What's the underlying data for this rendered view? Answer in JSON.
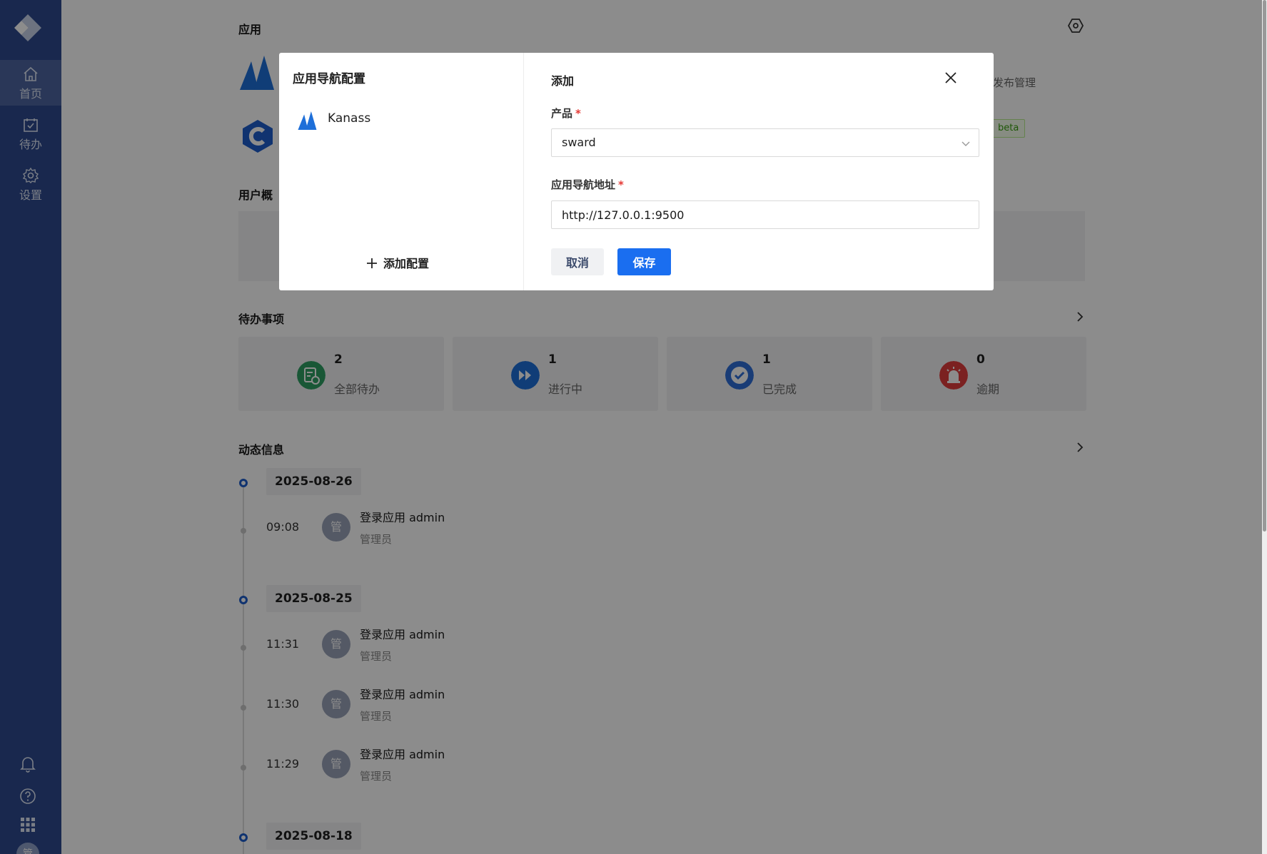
{
  "sidebar": {
    "items": [
      {
        "label": "首页",
        "icon": "home-icon"
      },
      {
        "label": "待办",
        "icon": "todo-icon"
      },
      {
        "label": "设置",
        "icon": "settings-icon"
      }
    ],
    "bottom_icons": [
      "bell-icon",
      "help-icon",
      "apps-grid-icon"
    ],
    "avatar_text": "管"
  },
  "main": {
    "apps_title": "应用",
    "apps_partial_text": "发布管理",
    "apps_badge": "beta",
    "users_title": "用户概",
    "todo_title": "待办事项",
    "todo_cards": [
      {
        "count": "2",
        "label": "全部待办",
        "color": "#2e9e63"
      },
      {
        "count": "1",
        "label": "进行中",
        "color": "#1e6fd9"
      },
      {
        "count": "1",
        "label": "已完成",
        "color": "#2f6ed8"
      },
      {
        "count": "0",
        "label": "逾期",
        "color": "#e03c3c"
      }
    ],
    "activity_title": "动态信息",
    "timeline": [
      {
        "date": "2025-08-26",
        "entries": [
          {
            "time": "09:08",
            "avatar": "管",
            "action": "登录应用 admin",
            "role": "管理员"
          }
        ]
      },
      {
        "date": "2025-08-25",
        "entries": [
          {
            "time": "11:31",
            "avatar": "管",
            "action": "登录应用 admin",
            "role": "管理员"
          },
          {
            "time": "11:30",
            "avatar": "管",
            "action": "登录应用 admin",
            "role": "管理员"
          },
          {
            "time": "11:29",
            "avatar": "管",
            "action": "登录应用 admin",
            "role": "管理员"
          }
        ]
      },
      {
        "date": "2025-08-18",
        "entries": []
      }
    ]
  },
  "modal": {
    "left_title": "应用导航配置",
    "config_items": [
      {
        "label": "Kanass"
      }
    ],
    "add_config_label": "添加配置",
    "form_title": "添加",
    "product_label": "产品",
    "product_value": "sward",
    "url_label": "应用导航地址",
    "url_value": "http://127.0.0.1:9500",
    "required_mark": "*",
    "cancel_label": "取消",
    "save_label": "保存"
  },
  "colors": {
    "sidebar_bg": "#2e4a8f",
    "primary": "#1a6ef0",
    "required": "#e53935"
  }
}
